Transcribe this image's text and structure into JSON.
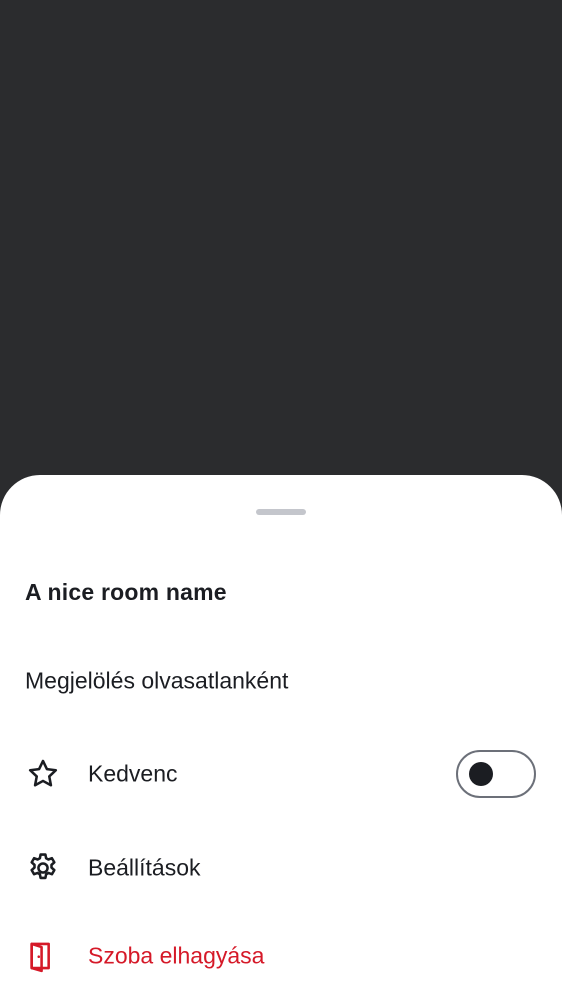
{
  "sheet": {
    "room_name": "A nice room name",
    "items": [
      {
        "label": "Megjelölés olvasatlanként",
        "icon": null
      },
      {
        "label": "Kedvenc",
        "icon": "star-icon",
        "toggle": false
      },
      {
        "label": "Beállítások",
        "icon": "settings-gear-icon"
      },
      {
        "label": "Szoba elhagyása",
        "icon": "leave-door-icon",
        "color": "#d51928"
      }
    ]
  },
  "colors": {
    "scrim": "#2b2c2e",
    "sheet": "#ffffff",
    "text": "#1b1d22",
    "destructive": "#d51928",
    "handle": "#c4c6cc"
  }
}
